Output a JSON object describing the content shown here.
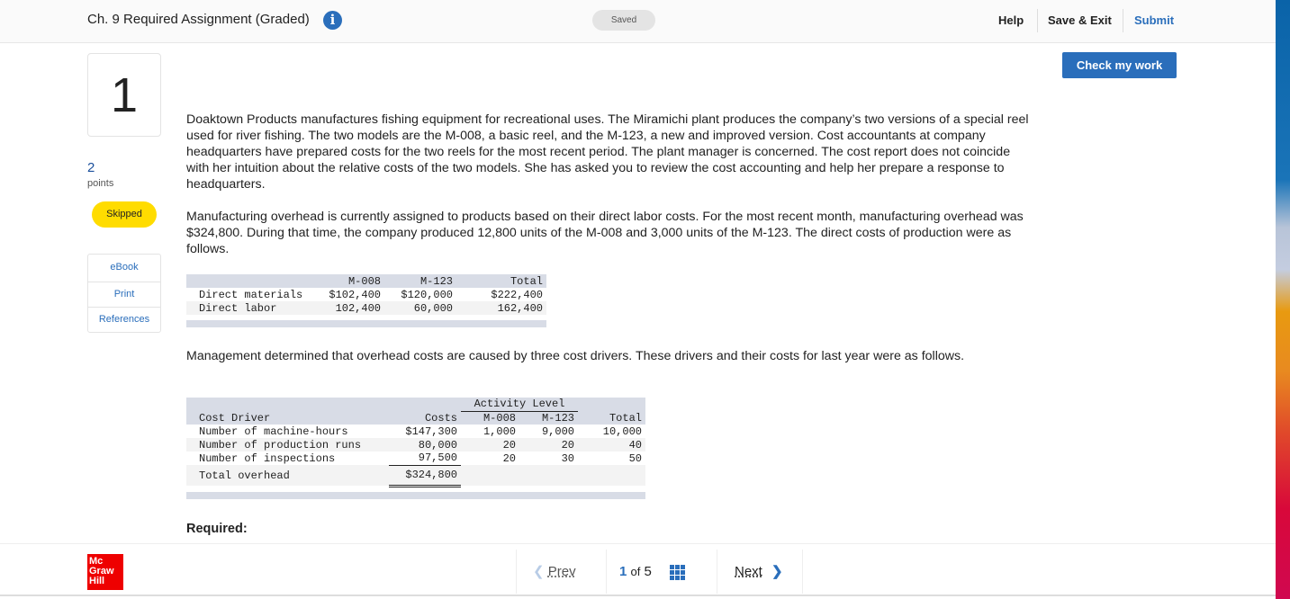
{
  "header": {
    "title": "Ch. 9 Required Assignment (Graded)",
    "info_icon": "info-icon",
    "status": "Saved",
    "help": "Help",
    "save_exit": "Save & Exit",
    "submit": "Submit"
  },
  "question": {
    "number": "1",
    "points": "2",
    "points_label": "points",
    "status": "Skipped",
    "check_label": "Check my work"
  },
  "sidebar": {
    "items": [
      {
        "label": "eBook"
      },
      {
        "label": "Print"
      },
      {
        "label": "References"
      }
    ]
  },
  "body": {
    "p1": "Doaktown Products manufactures fishing equipment for recreational uses. The Miramichi plant produces the company’s two versions of a special reel used for river fishing. The two models are the M-008, a basic reel, and the M-123, a new and improved version. Cost accountants at company headquarters have prepared costs for the two reels for the most recent period. The plant manager is concerned. The cost report does not coincide with her intuition about the relative costs of the two models. She has asked you to review the cost accounting and help her prepare a response to headquarters.",
    "p2": "Manufacturing overhead is currently assigned to products based on their direct labor costs. For the most recent month, manufacturing overhead was $324,800. During that time, the company produced 12,800 units of the M-008 and 3,000 units of the M-123. The direct costs of production were as follows.",
    "p3": "Management determined that overhead costs are caused by three cost drivers. These drivers and their costs for last year were as follows.",
    "required": "Required:"
  },
  "table1": {
    "headers": [
      "",
      "M-008",
      "M-123",
      "Total"
    ],
    "rows": [
      [
        "Direct materials",
        "$102,400",
        "$120,000",
        "$222,400"
      ],
      [
        "Direct labor",
        "102,400",
        "60,000",
        "162,400"
      ]
    ]
  },
  "table2": {
    "group_header": "Activity Level",
    "headers": [
      "Cost Driver",
      "Costs",
      "M-008",
      "M-123",
      "Total"
    ],
    "rows": [
      [
        "Number of machine-hours",
        "$147,300",
        "1,000",
        "9,000",
        "10,000"
      ],
      [
        "Number of production runs",
        "80,000",
        "20",
        "20",
        "40"
      ],
      [
        "Number of inspections",
        "97,500",
        "20",
        "30",
        "50"
      ]
    ],
    "total": [
      "Total overhead",
      "$324,800"
    ]
  },
  "footer": {
    "logo": "Mc Graw Hill",
    "prev": "Prev",
    "current": "1",
    "of": "of",
    "total": "5",
    "next": "Next"
  }
}
